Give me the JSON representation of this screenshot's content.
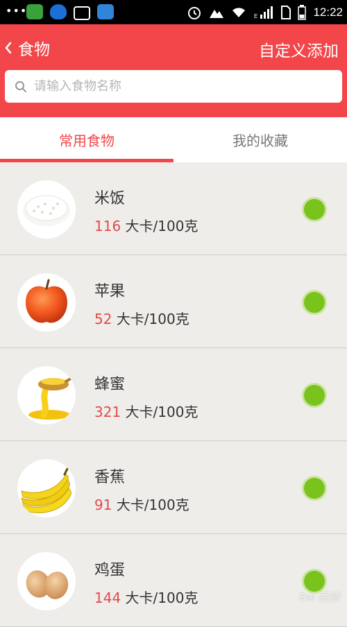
{
  "status_bar": {
    "time": "12:22",
    "network": "E"
  },
  "header": {
    "back_label": "食物",
    "action_label": "自定义添加"
  },
  "search": {
    "placeholder": "请输入食物名称",
    "value": ""
  },
  "tabs": [
    {
      "label": "常用食物",
      "active": true
    },
    {
      "label": "我的收藏",
      "active": false
    }
  ],
  "foods": [
    {
      "name": "米饭",
      "calories": "116",
      "unit": "大卡/100克",
      "icon": "rice-icon"
    },
    {
      "name": "苹果",
      "calories": "52",
      "unit": "大卡/100克",
      "icon": "apple-icon"
    },
    {
      "name": "蜂蜜",
      "calories": "321",
      "unit": "大卡/100克",
      "icon": "honey-icon"
    },
    {
      "name": "香蕉",
      "calories": "91",
      "unit": "大卡/100克",
      "icon": "banana-icon"
    },
    {
      "name": "鸡蛋",
      "calories": "144",
      "unit": "大卡/100克",
      "icon": "egg-icon"
    }
  ],
  "colors": {
    "brand": "#f3464a",
    "calorie": "#e14b4b",
    "status_dot": "#7ac21c"
  },
  "watermark": "Bai 经验"
}
